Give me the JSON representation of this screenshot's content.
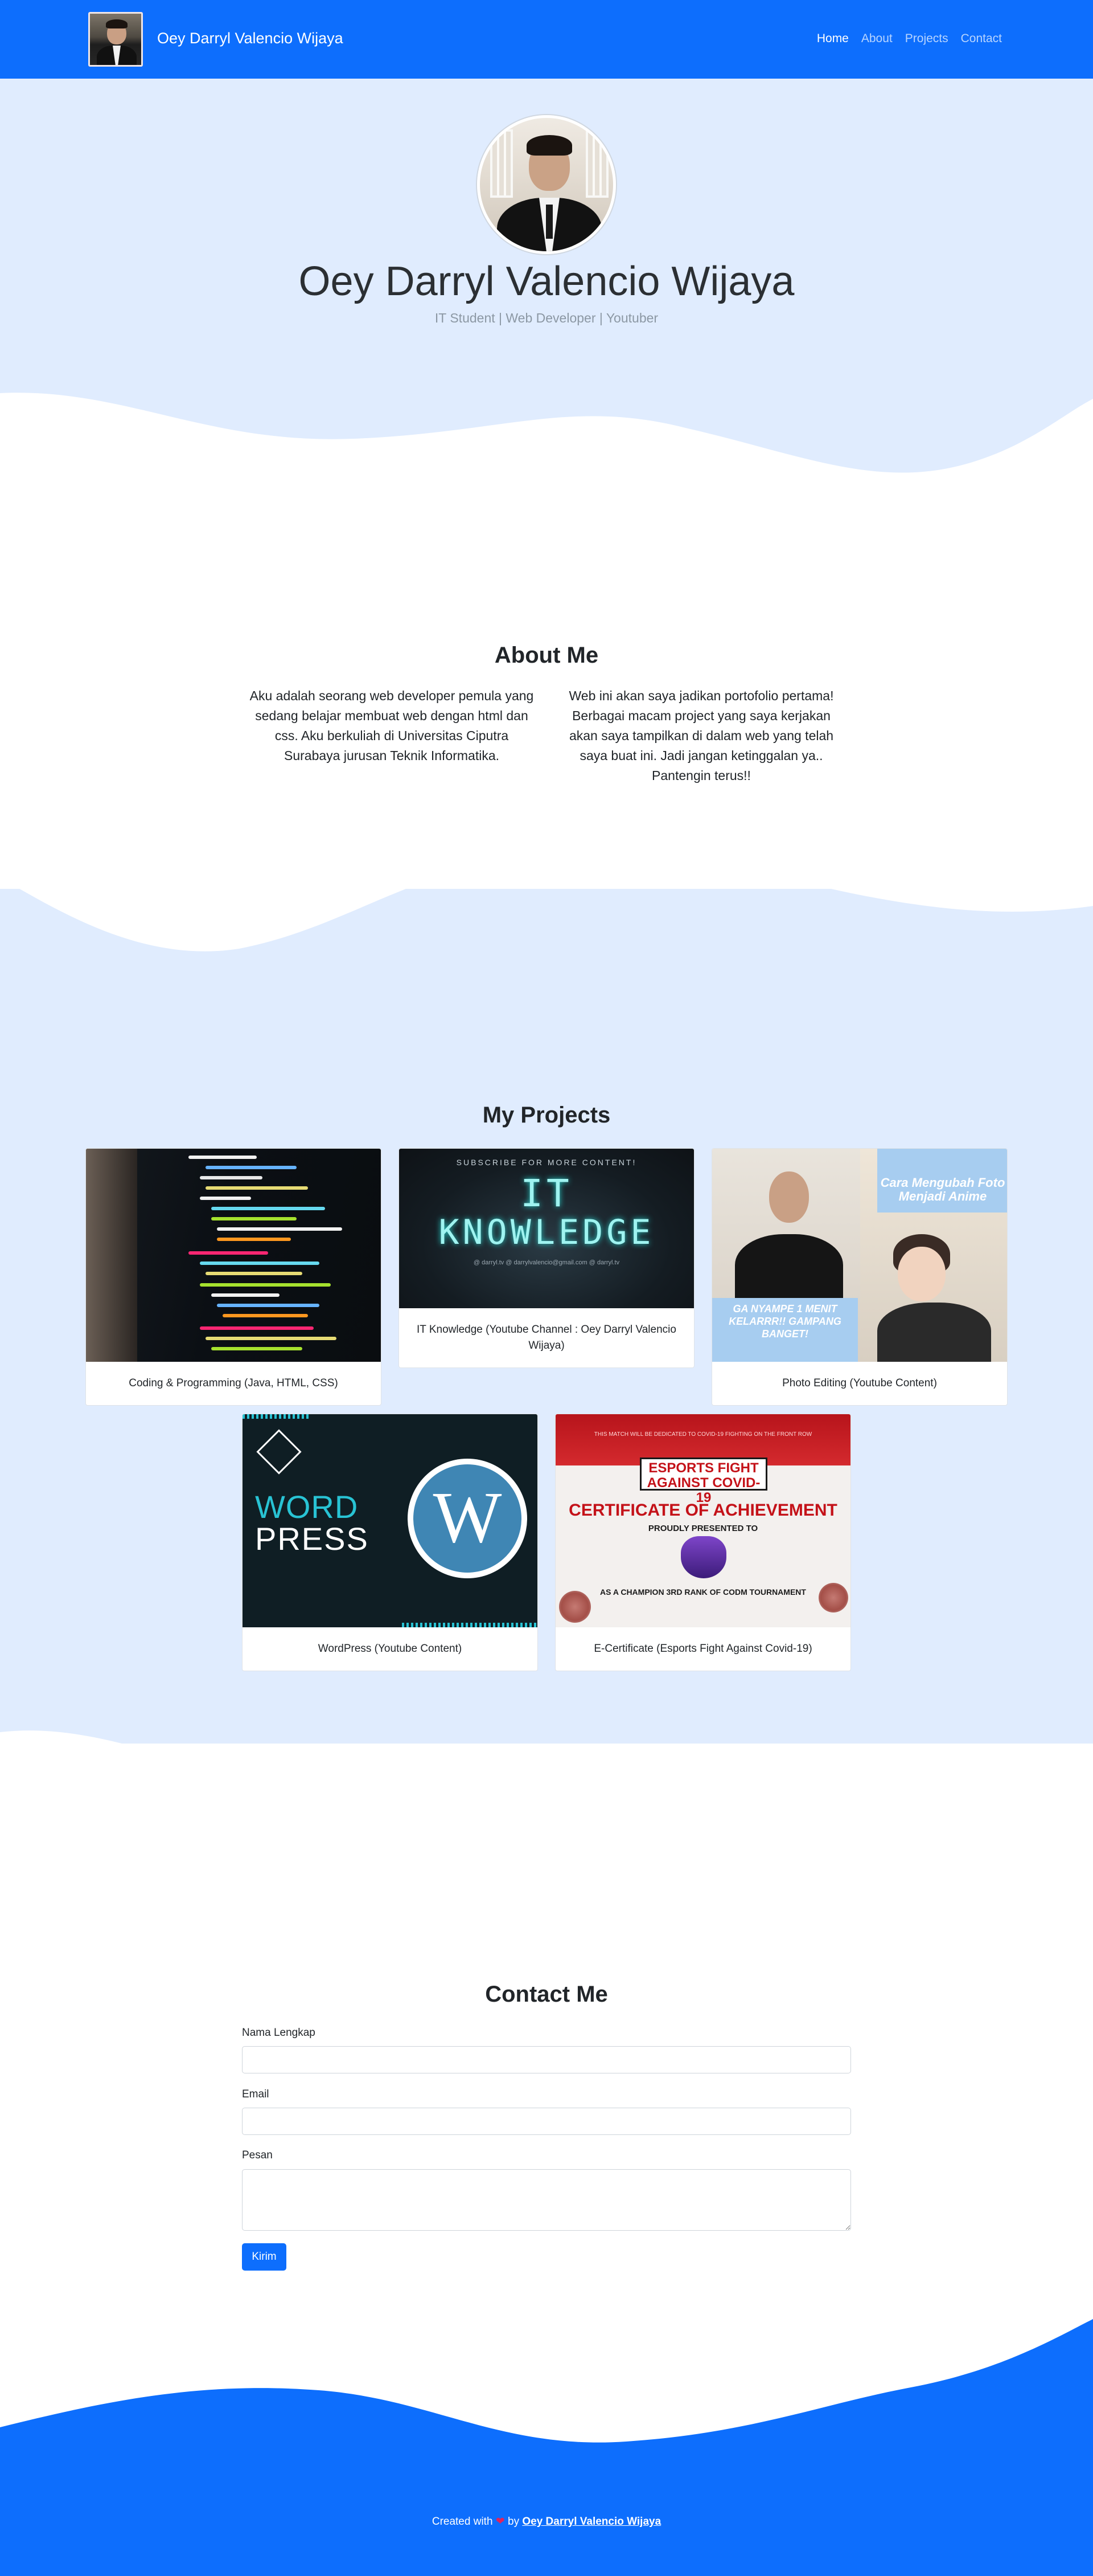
{
  "navbar": {
    "brand": "Oey Darryl Valencio Wijaya",
    "links": [
      "Home",
      "About",
      "Projects",
      "Contact"
    ],
    "active": "Home"
  },
  "hero": {
    "name": "Oey Darryl Valencio Wijaya",
    "subtitle": "IT Student | Web Developer | Youtuber"
  },
  "about": {
    "title": "About Me",
    "paragraphs": [
      "Aku adalah seorang web developer pemula yang sedang belajar membuat web dengan html dan css. Aku berkuliah di Universitas Ciputra Surabaya jurusan Teknik Informatika.",
      "Web ini akan saya jadikan portofolio pertama! Berbagai macam project yang saya kerjakan akan saya tampilkan di dalam web yang telah saya buat ini. Jadi jangan ketinggalan ya.. Pantengin terus!!"
    ]
  },
  "projects": {
    "title": "My Projects",
    "items": [
      {
        "caption": "Coding & Programming (Java, HTML, CSS)"
      },
      {
        "caption": "IT Knowledge (Youtube Channel : Oey Darryl Valencio Wijaya)",
        "art": {
          "top": "SUBSCRIBE FOR MORE CONTENT!",
          "line1": "IT",
          "line2": "KNOWLEDGE",
          "social": "@ darryl.tv   @ darrylvalencio@gmail.com   @ darryl.tv"
        }
      },
      {
        "caption": "Photo Editing (Youtube Content)",
        "art": {
          "title": "Cara Mengubah Foto Menjadi Anime",
          "sub": "GA NYAMPE 1 MENIT KELARRR!! GAMPANG BANGET!"
        }
      },
      {
        "caption": "WordPress (Youtube Content)",
        "art": {
          "word": "WORD",
          "press": "PRESS",
          "logo": "W"
        }
      },
      {
        "caption": "E-Certificate (Esports Fight Against Covid-19)",
        "art": {
          "header": "THIS MATCH WILL BE DEDICATED TO COVID-19 FIGHTING ON THE FRONT ROW",
          "fight": "ESPORTS FIGHT AGAINST COVID-19",
          "cert": "CERTIFICATE OF ACHIEVEMENT",
          "proud": "PROUDLY PRESENTED TO",
          "champ": "AS A CHAMPION 3RD RANK OF CODM TOURNAMENT"
        }
      }
    ]
  },
  "contact": {
    "title": "Contact Me",
    "fields": {
      "name_label": "Nama Lengkap",
      "email_label": "Email",
      "message_label": "Pesan",
      "name_value": "",
      "email_value": "",
      "message_value": ""
    },
    "submit": "Kirim"
  },
  "footer": {
    "prefix": "Created with",
    "heart": "❤",
    "by": "by",
    "author": "Oey Darryl Valencio Wijaya"
  },
  "colors": {
    "primary": "#0d6efd",
    "light_bg": "#e0ecfe"
  }
}
